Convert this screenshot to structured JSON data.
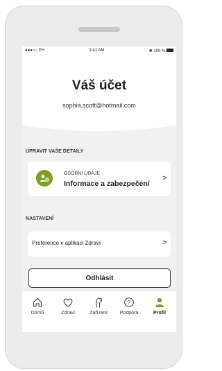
{
  "status_bar": {
    "carrier": "●●●○○ PH",
    "time": "9:41 AM",
    "battery": "100 %"
  },
  "header": {
    "title": "Váš účet",
    "email": "sophia.scott@hotmail.com"
  },
  "details_section": {
    "label": "UPRAVIT VAŠE DETAILY",
    "card": {
      "icon": "user-settings-icon",
      "small_label": "OSOBNÍ ÚDAJE",
      "title": "Informace a zabezpečení",
      "chevron": ">"
    }
  },
  "settings_section": {
    "label": "NASTAVENÍ",
    "item": {
      "label": "Preference v aplikaci Zdraví",
      "chevron": ">"
    }
  },
  "logout_label": "Odhlásit",
  "tabs": [
    {
      "label": "Domů",
      "icon": "home-icon",
      "active": false
    },
    {
      "label": "Zdraví",
      "icon": "heart-icon",
      "active": false
    },
    {
      "label": "Zařízení",
      "icon": "hearing-aid-icon",
      "active": false
    },
    {
      "label": "Podpora",
      "icon": "help-icon",
      "active": false
    },
    {
      "label": "Profil",
      "icon": "profile-icon",
      "active": true
    }
  ],
  "colors": {
    "accent": "#7aa31e",
    "background": "#f1f1f1",
    "card": "#ffffff"
  }
}
